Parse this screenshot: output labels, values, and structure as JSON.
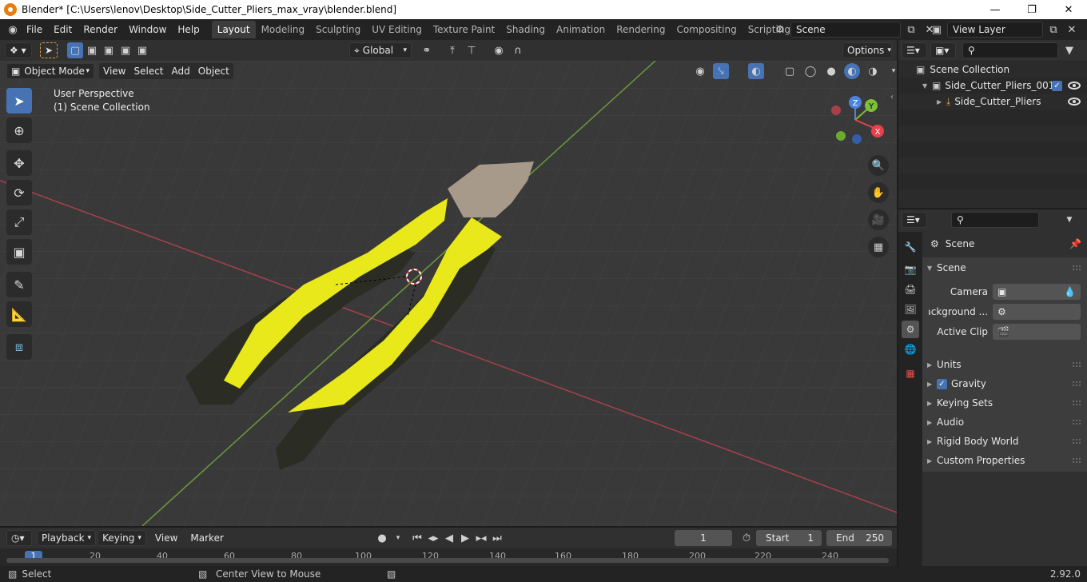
{
  "title": "Blender* [C:\\Users\\lenov\\Desktop\\Side_Cutter_Pliers_max_vray\\blender.blend]",
  "menu": [
    "File",
    "Edit",
    "Render",
    "Window",
    "Help"
  ],
  "workspaces": [
    "Layout",
    "Modeling",
    "Sculpting",
    "UV Editing",
    "Texture Paint",
    "Shading",
    "Animation",
    "Rendering",
    "Compositing",
    "Scripting"
  ],
  "active_workspace": "Layout",
  "scene_name": "Scene",
  "view_layer": "View Layer",
  "viewport": {
    "transform_orientation": "Global",
    "options_label": "Options",
    "mode": "Object Mode",
    "menus": [
      "View",
      "Select",
      "Add",
      "Object"
    ],
    "overlay_line1": "User Perspective",
    "overlay_line2": "(1) Scene Collection",
    "gizmo_axes": [
      "Z",
      "Y",
      "X"
    ]
  },
  "outliner": {
    "root": "Scene Collection",
    "collection": "Side_Cutter_Pliers_001",
    "object": "Side_Cutter_Pliers"
  },
  "properties": {
    "context": "Scene",
    "section_scene": "Scene",
    "camera_label": "Camera",
    "background_label": "Background ...",
    "active_clip_label": "Active Clip",
    "panels": [
      "Units",
      "Gravity",
      "Keying Sets",
      "Audio",
      "Rigid Body World",
      "Custom Properties"
    ],
    "gravity_checked": true
  },
  "timeline": {
    "menus": [
      "Playback",
      "Keying",
      "View",
      "Marker"
    ],
    "current_frame": "1",
    "start_label": "Start",
    "start_value": "1",
    "end_label": "End",
    "end_value": "250",
    "ruler": [
      "1",
      "20",
      "40",
      "60",
      "80",
      "100",
      "120",
      "140",
      "160",
      "180",
      "200",
      "220",
      "240"
    ]
  },
  "status": {
    "select": "Select",
    "center": "Center View to Mouse",
    "version": "2.92.0"
  },
  "colors": {
    "accent": "#4772b3",
    "pliers_yellow": "#e8e81a",
    "x_axis": "#e8414a",
    "y_axis": "#7bbf3a",
    "z_axis": "#4a84e0"
  }
}
